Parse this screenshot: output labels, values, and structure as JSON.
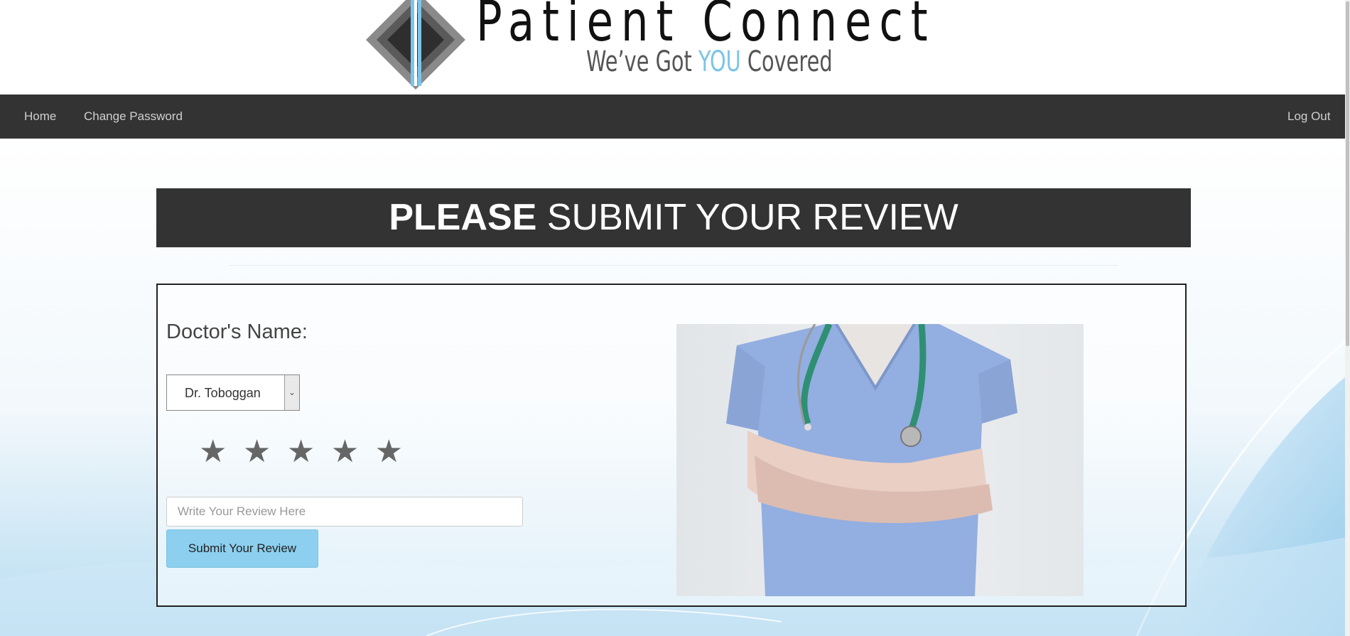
{
  "header": {
    "logo_title": "Patient Connect",
    "tagline_pre": "We’ve Got ",
    "tagline_accent": "YOU",
    "tagline_post": " Covered"
  },
  "nav": {
    "home": "Home",
    "change_password": "Change Password",
    "log_out": "Log Out"
  },
  "banner": {
    "bold": "PLEASE",
    "rest": " SUBMIT YOUR REVIEW"
  },
  "form": {
    "doctor_label": "Doctor's Name:",
    "doctor_selected": "Dr. Toboggan",
    "star_glyph": "★",
    "rating_max": 5,
    "review_placeholder": "Write Your Review Here",
    "review_value": "",
    "submit_label": "Submit Your Review"
  },
  "colors": {
    "nav_bg": "#333333",
    "accent_blue": "#8ccfee",
    "logo_accent": "#7cc4e8"
  },
  "icons": {
    "logo": "diamond-logo-icon",
    "select_arrow": "chevron-down-icon",
    "rating": "star-icon"
  }
}
